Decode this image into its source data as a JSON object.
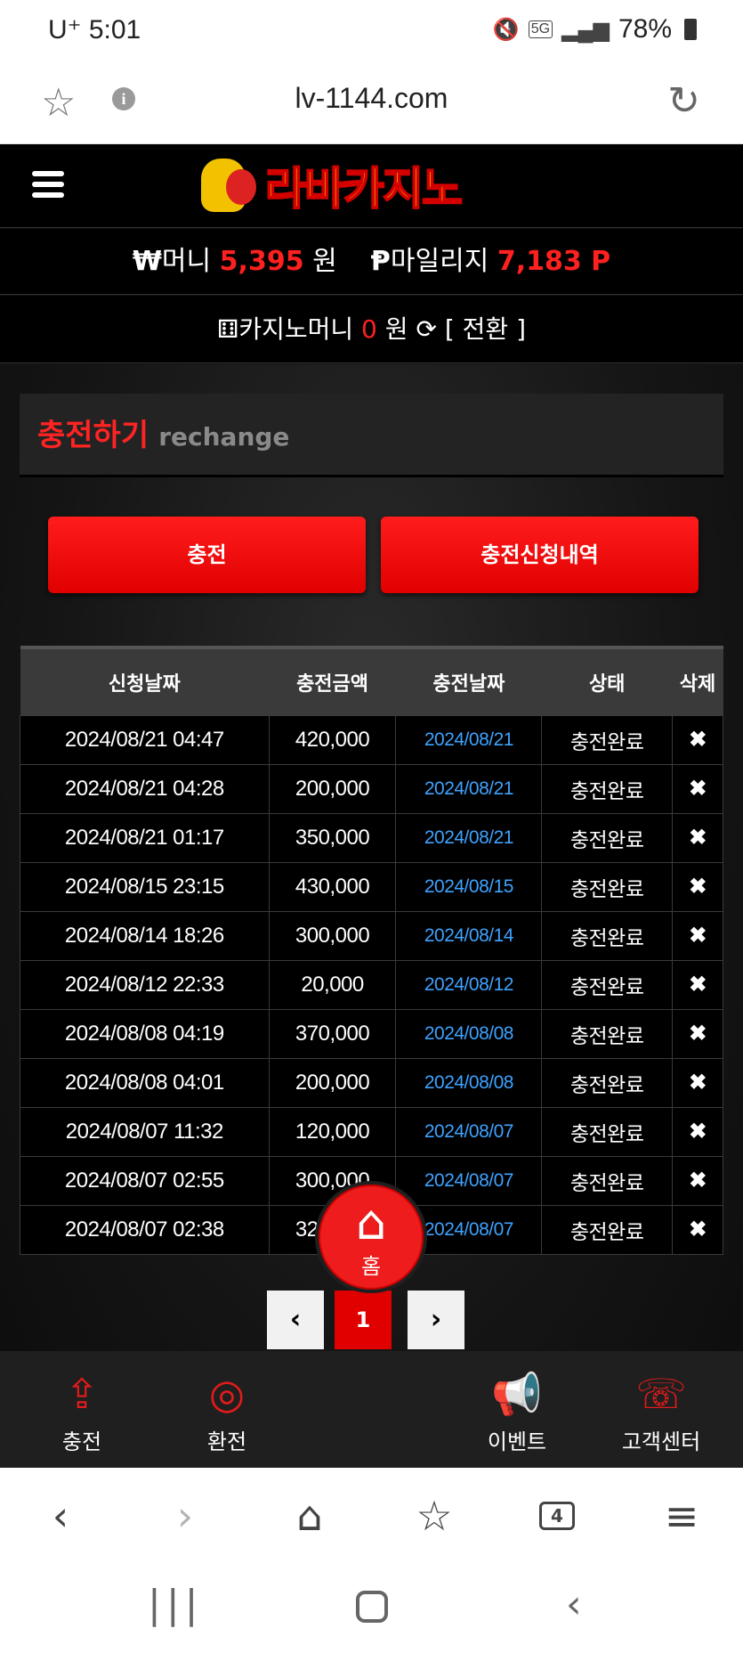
{
  "status_bar": {
    "time": "U⁺ 5:01",
    "battery": "78%",
    "icons": [
      "mute-icon",
      "5g-icon",
      "signal-icon",
      "battery-icon"
    ]
  },
  "browser": {
    "url": "lv-1144.com"
  },
  "site": {
    "logo_text": "라바카지노",
    "money": {
      "currency_symbol": "₩",
      "label": "머니",
      "value": "5,395",
      "unit": "원"
    },
    "mileage": {
      "symbol": "Ᵽ",
      "label": "마일리지",
      "value": "7,183 P"
    },
    "casino_money": {
      "label": "카지노머니",
      "value": "0",
      "unit": "원",
      "convert_label": "[ 전환 ]"
    },
    "recharge": {
      "title_ko": "충전하기",
      "title_en": "rechange",
      "charge_button": "충전",
      "history_button": "충전신청내역"
    },
    "table": {
      "headers": [
        "신청날짜",
        "충전금액",
        "충전날짜",
        "상태",
        "삭제"
      ],
      "rows": [
        {
          "requested": "2024/08/21 04:47",
          "amount": "420,000",
          "charged": "2024/08/21",
          "status": "충전완료",
          "delete": "✖"
        },
        {
          "requested": "2024/08/21 04:28",
          "amount": "200,000",
          "charged": "2024/08/21",
          "status": "충전완료",
          "delete": "✖"
        },
        {
          "requested": "2024/08/21 01:17",
          "amount": "350,000",
          "charged": "2024/08/21",
          "status": "충전완료",
          "delete": "✖"
        },
        {
          "requested": "2024/08/15 23:15",
          "amount": "430,000",
          "charged": "2024/08/15",
          "status": "충전완료",
          "delete": "✖"
        },
        {
          "requested": "2024/08/14 18:26",
          "amount": "300,000",
          "charged": "2024/08/14",
          "status": "충전완료",
          "delete": "✖"
        },
        {
          "requested": "2024/08/12 22:33",
          "amount": "20,000",
          "charged": "2024/08/12",
          "status": "충전완료",
          "delete": "✖"
        },
        {
          "requested": "2024/08/08 04:19",
          "amount": "370,000",
          "charged": "2024/08/08",
          "status": "충전완료",
          "delete": "✖"
        },
        {
          "requested": "2024/08/08 04:01",
          "amount": "200,000",
          "charged": "2024/08/08",
          "status": "충전완료",
          "delete": "✖"
        },
        {
          "requested": "2024/08/07 11:32",
          "amount": "120,000",
          "charged": "2024/08/07",
          "status": "충전완료",
          "delete": "✖"
        },
        {
          "requested": "2024/08/07 02:55",
          "amount": "300,000",
          "charged": "2024/08/07",
          "status": "충전완료",
          "delete": "✖"
        },
        {
          "requested": "2024/08/07 02:38",
          "amount": "320,000",
          "charged": "2024/08/07",
          "status": "충전완료",
          "delete": "✖"
        }
      ]
    },
    "pagination": {
      "current": "1",
      "prev": "‹",
      "next": "›"
    },
    "bottom_nav": {
      "charge": "충전",
      "exchange": "환전",
      "home": "홈",
      "event": "이벤트",
      "support": "고객센터"
    }
  },
  "browser_toolbar": {
    "tab_count": "4"
  },
  "colors": {
    "accent_red": "#e00000",
    "link_blue": "#3ea2ff",
    "bg_dark": "#111111"
  }
}
